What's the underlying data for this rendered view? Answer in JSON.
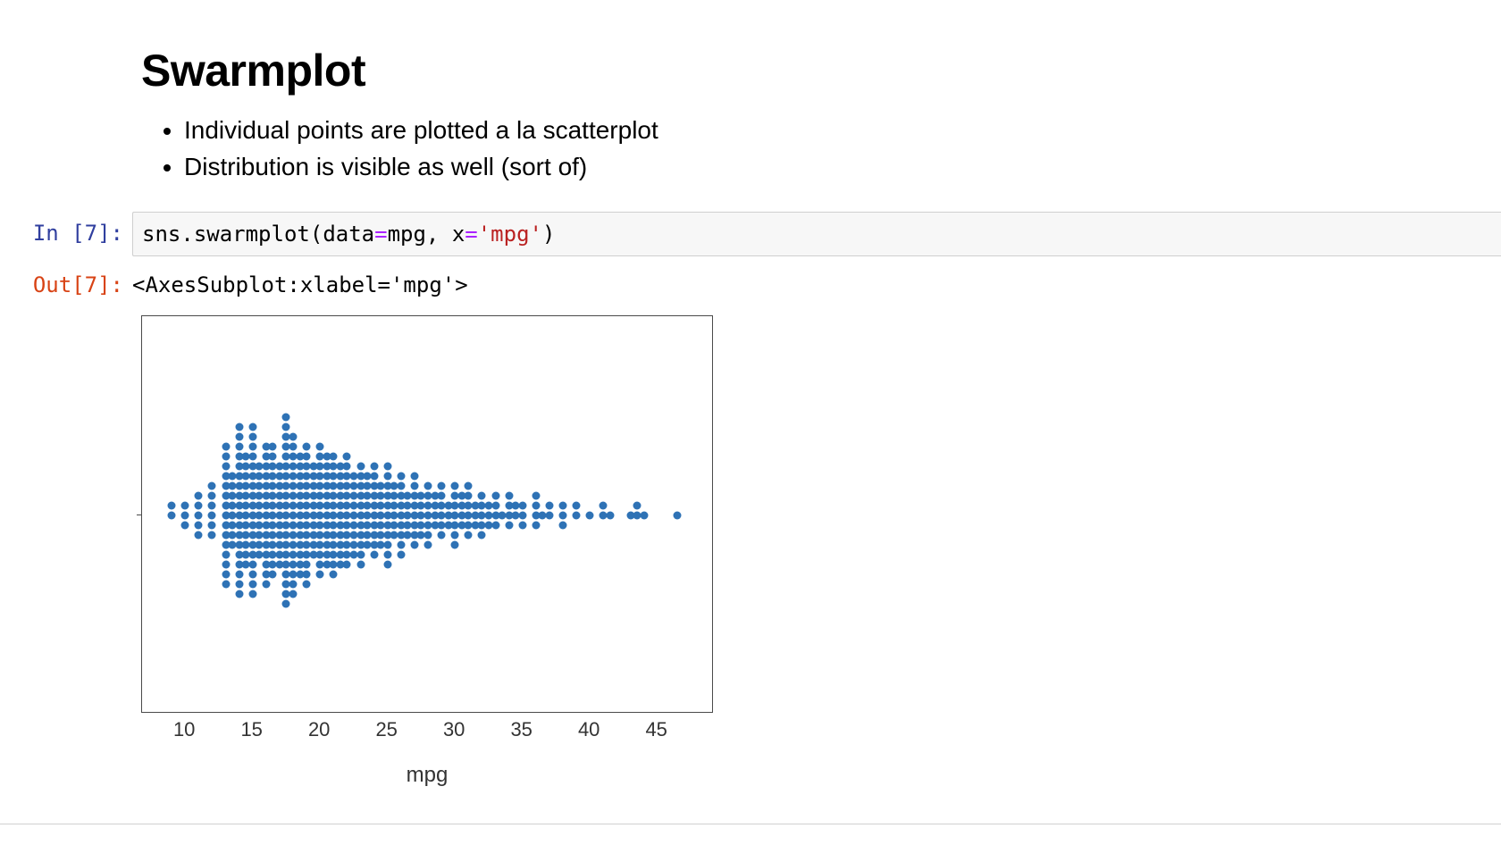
{
  "heading": "Swarmplot",
  "bullets": [
    "Individual points are plotted a la scatterplot",
    "Distribution is visible as well (sort of)"
  ],
  "cell": {
    "in_prompt": "In [7]:",
    "out_prompt": "Out[7]:",
    "code_tokens": {
      "t1": "sns",
      "t2": ".",
      "t3": "swarmplot",
      "t4": "(",
      "t5": "data",
      "t6": "=",
      "t7": "mpg",
      "t8": ", ",
      "t9": "x",
      "t10": "=",
      "t11": "'mpg'",
      "t12": ")"
    },
    "output_text": "<AxesSubplot:xlabel='mpg'>"
  },
  "chart_data": {
    "type": "swarm",
    "xlabel": "mpg",
    "xlim": [
      8,
      48
    ],
    "x_ticks": [
      10,
      15,
      20,
      25,
      30,
      35,
      40,
      45
    ],
    "point_color": "#2e72b5",
    "data": [
      {
        "x": 9,
        "n": 2
      },
      {
        "x": 10,
        "n": 3
      },
      {
        "x": 11,
        "n": 5
      },
      {
        "x": 12,
        "n": 6
      },
      {
        "x": 13,
        "n": 15
      },
      {
        "x": 13.5,
        "n": 8
      },
      {
        "x": 14,
        "n": 18
      },
      {
        "x": 14.5,
        "n": 12
      },
      {
        "x": 15,
        "n": 18
      },
      {
        "x": 15.5,
        "n": 10
      },
      {
        "x": 16,
        "n": 15
      },
      {
        "x": 16.5,
        "n": 14
      },
      {
        "x": 17,
        "n": 11
      },
      {
        "x": 17.5,
        "n": 20
      },
      {
        "x": 18,
        "n": 17
      },
      {
        "x": 18.5,
        "n": 13
      },
      {
        "x": 19,
        "n": 15
      },
      {
        "x": 19.5,
        "n": 10
      },
      {
        "x": 20,
        "n": 14
      },
      {
        "x": 20.5,
        "n": 12
      },
      {
        "x": 21,
        "n": 13
      },
      {
        "x": 21.5,
        "n": 11
      },
      {
        "x": 22,
        "n": 12
      },
      {
        "x": 22.5,
        "n": 9
      },
      {
        "x": 23,
        "n": 11
      },
      {
        "x": 23.5,
        "n": 8
      },
      {
        "x": 24,
        "n": 10
      },
      {
        "x": 24.5,
        "n": 7
      },
      {
        "x": 25,
        "n": 11
      },
      {
        "x": 25.5,
        "n": 6
      },
      {
        "x": 26,
        "n": 9
      },
      {
        "x": 26.5,
        "n": 5
      },
      {
        "x": 27,
        "n": 8
      },
      {
        "x": 27.5,
        "n": 5
      },
      {
        "x": 28,
        "n": 7
      },
      {
        "x": 28.5,
        "n": 4
      },
      {
        "x": 29,
        "n": 6
      },
      {
        "x": 29.5,
        "n": 3
      },
      {
        "x": 30,
        "n": 7
      },
      {
        "x": 30.5,
        "n": 4
      },
      {
        "x": 31,
        "n": 6
      },
      {
        "x": 31.5,
        "n": 3
      },
      {
        "x": 32,
        "n": 5
      },
      {
        "x": 32.5,
        "n": 3
      },
      {
        "x": 33,
        "n": 4
      },
      {
        "x": 33.5,
        "n": 1
      },
      {
        "x": 34,
        "n": 4
      },
      {
        "x": 34.5,
        "n": 2
      },
      {
        "x": 35,
        "n": 3
      },
      {
        "x": 36,
        "n": 4
      },
      {
        "x": 36.5,
        "n": 1
      },
      {
        "x": 37,
        "n": 2
      },
      {
        "x": 38,
        "n": 3
      },
      {
        "x": 39,
        "n": 2
      },
      {
        "x": 40,
        "n": 1
      },
      {
        "x": 41,
        "n": 2
      },
      {
        "x": 41.5,
        "n": 1
      },
      {
        "x": 43,
        "n": 1
      },
      {
        "x": 43.5,
        "n": 2
      },
      {
        "x": 44,
        "n": 1
      },
      {
        "x": 46.5,
        "n": 1
      }
    ]
  }
}
